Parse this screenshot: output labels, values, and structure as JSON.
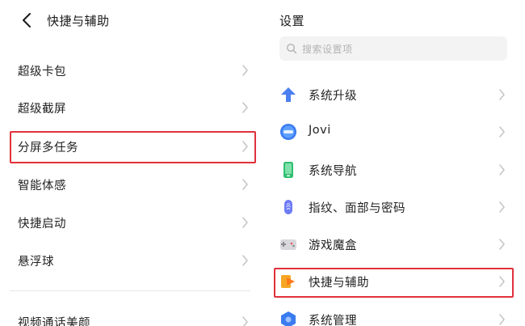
{
  "left_panel": {
    "title": "快捷与辅助",
    "items": [
      {
        "label": "超级卡包"
      },
      {
        "label": "超级截屏"
      },
      {
        "label": "分屏多任务"
      },
      {
        "label": "智能体感"
      },
      {
        "label": "快捷启动"
      },
      {
        "label": "悬浮球"
      },
      {
        "label": "视频通话美颜"
      }
    ]
  },
  "right_panel": {
    "title": "设置",
    "search_placeholder": "搜索设置项",
    "items": [
      {
        "label": "系统升级",
        "icon": "system-upgrade-icon"
      },
      {
        "label": "Jovi",
        "icon": "jovi-icon"
      },
      {
        "label": "系统导航",
        "icon": "system-navigation-icon"
      },
      {
        "label": "指纹、面部与密码",
        "icon": "fingerprint-icon"
      },
      {
        "label": "游戏魔盒",
        "icon": "game-box-icon"
      },
      {
        "label": "快捷与辅助",
        "icon": "shortcuts-icon"
      },
      {
        "label": "系统管理",
        "icon": "system-management-icon"
      }
    ]
  },
  "colors": {
    "highlight": "#e0313b",
    "chevron": "#c4c4c4",
    "search_bg": "#f3f3f3"
  }
}
